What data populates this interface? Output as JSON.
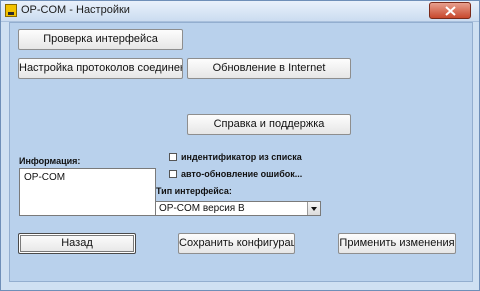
{
  "window": {
    "title": "OP-COM - Настройки",
    "icon": "opcom-app-icon",
    "close_icon": "close-icon"
  },
  "buttons": {
    "check_interface": "Проверка интерфейса",
    "protocol_setup": "Настройка протоколов соединения",
    "internet_update": "Обновление в Internet",
    "help_support": "Справка и поддержка",
    "back": "Назад",
    "save_config": "Сохранить конфигурацию",
    "apply_changes": "Применить изменения"
  },
  "info": {
    "label": "Информация:",
    "value": "OP-COM"
  },
  "options": {
    "id_from_list": {
      "label": "индентификатор из списка",
      "checked": false
    },
    "auto_update_errors": {
      "label": "авто-обновление ошибок...",
      "checked": false
    }
  },
  "interface_type": {
    "label": "Тип интерфейса:",
    "selected": "OP-COM версия B"
  }
}
